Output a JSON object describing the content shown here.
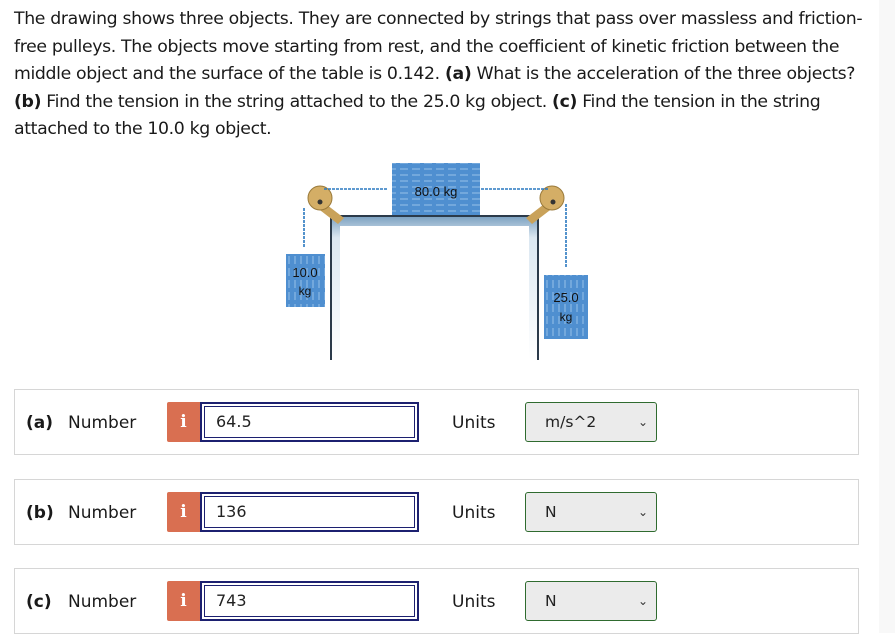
{
  "question": {
    "intro": "The drawing shows three objects. They are connected by strings that pass over massless and friction-free pulleys. The objects move starting from rest, and the coefficient of kinetic friction between the middle object and the surface of the table is 0.142.",
    "part_a_label": "(a)",
    "part_a_text": "What is the acceleration of the three objects?",
    "part_b_label": "(b)",
    "part_b_text": "Find the tension in the string attached to the 25.0 kg object.",
    "part_c_label": "(c)",
    "part_c_text": "Find the tension in the string attached to the 10.0 kg object."
  },
  "figure": {
    "middle_mass": "80.0 kg",
    "left_mass_value": "10.0",
    "left_mass_unit": "kg",
    "right_mass_value": "25.0",
    "right_mass_unit": "kg",
    "colors": {
      "block": "#4f8fd0",
      "table": "#8fb0cc",
      "pulley": "#c9a25a",
      "string": "#2a78c0"
    }
  },
  "answers": [
    {
      "part": "(a)",
      "number_label": "Number",
      "info_icon": "i",
      "value": "64.5",
      "units_label": "Units",
      "unit": "m/s^2"
    },
    {
      "part": "(b)",
      "number_label": "Number",
      "info_icon": "i",
      "value": "136",
      "units_label": "Units",
      "unit": "N"
    },
    {
      "part": "(c)",
      "number_label": "Number",
      "info_icon": "i",
      "value": "743",
      "units_label": "Units",
      "unit": "N"
    }
  ],
  "colors": {
    "info_button": "#d96f51",
    "input_border": "#1c2070",
    "select_border": "#2f6b2f",
    "select_bg": "#ebebeb"
  }
}
